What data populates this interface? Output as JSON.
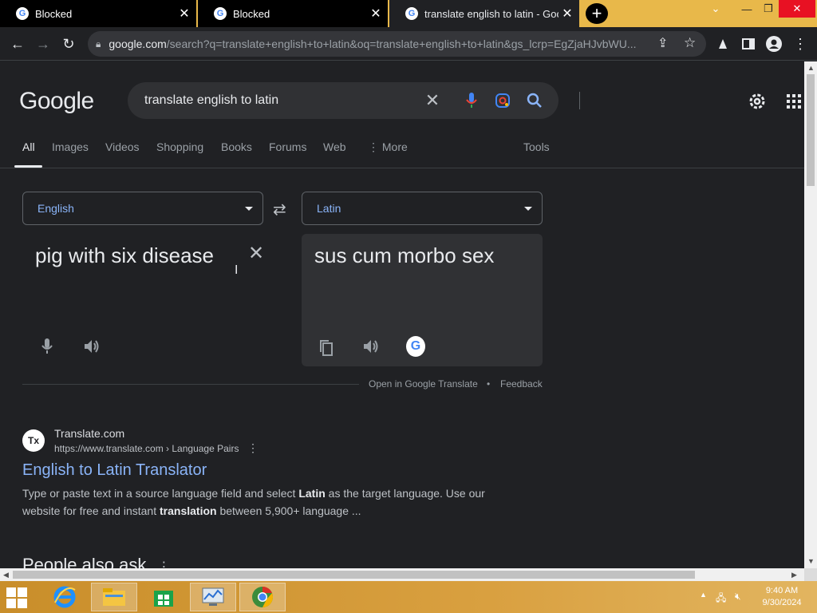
{
  "tabs": [
    {
      "title": "Blocked",
      "state": "inactive"
    },
    {
      "title": "Blocked",
      "state": "inactive"
    },
    {
      "title": "translate english to latin - Goog",
      "state": "active"
    }
  ],
  "address_bar": {
    "host": "google.com",
    "path": "/search?q=translate+english+to+latin&oq=translate+english+to+latin&gs_lcrp=EgZjaHJvbWU..."
  },
  "google": {
    "logo": "Google",
    "query": "translate english to latin"
  },
  "nav": {
    "items": [
      "All",
      "Images",
      "Videos",
      "Shopping",
      "Books",
      "Forums",
      "Web",
      "More"
    ],
    "tools": "Tools",
    "active": "All"
  },
  "translate": {
    "source_language": "English",
    "target_language": "Latin",
    "source_text": "pig with six disease",
    "target_text": "sus cum morbo sex",
    "open_link": "Open in Google Translate",
    "separator": "•",
    "feedback": "Feedback"
  },
  "result": {
    "favicon_text": "Tx",
    "site": "Translate.com",
    "url": "https://www.translate.com › Language Pairs",
    "title": "English to Latin Translator",
    "snippet_parts": [
      "Type or paste text in a source language field and select ",
      "Latin",
      " as the target language. Use our website for free and instant ",
      "translation",
      " between 5,900+ language ..."
    ]
  },
  "people_also_ask": "People also ask",
  "taskbar": {
    "time": "9:40 AM",
    "date": "9/30/2024"
  },
  "colors": {
    "link": "#8ab4f8",
    "background": "#202124",
    "taskbar": "#d9a040"
  }
}
